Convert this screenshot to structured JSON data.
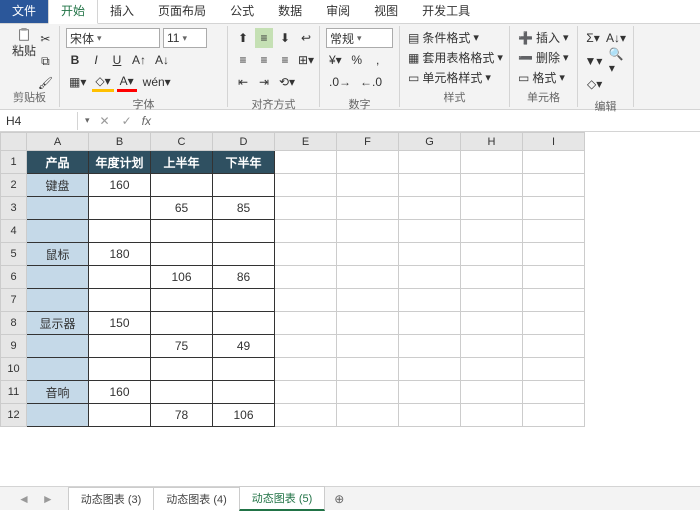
{
  "menu": {
    "file": "文件",
    "home": "开始",
    "insert": "插入",
    "layout": "页面布局",
    "formula": "公式",
    "data": "数据",
    "review": "审阅",
    "view": "视图",
    "dev": "开发工具"
  },
  "ribbon": {
    "paste": "粘贴",
    "clipboard": "剪贴板",
    "font": "宋体",
    "fontsize": "11",
    "fontlabel": "字体",
    "b": "B",
    "i": "I",
    "u": "U",
    "alignlabel": "对齐方式",
    "numberfmt": "常规",
    "numberlabel": "数字",
    "condfmt": "条件格式",
    "tablefmt": "套用表格格式",
    "cellstyle": "单元格样式",
    "styleslabel": "样式",
    "ins": "插入",
    "del": "删除",
    "fmt": "格式",
    "cellslabel": "单元格",
    "editlabel": "编辑"
  },
  "namebox": "H4",
  "cols": [
    "A",
    "B",
    "C",
    "D",
    "E",
    "F",
    "G",
    "H",
    "I"
  ],
  "rows": [
    {
      "n": "1",
      "c": [
        {
          "t": "hdr",
          "v": "产品"
        },
        {
          "t": "hdr",
          "v": "年度计划"
        },
        {
          "t": "hdr",
          "v": "上半年"
        },
        {
          "t": "hdr",
          "v": "下半年"
        }
      ]
    },
    {
      "n": "2",
      "c": [
        {
          "t": "lab",
          "v": "键盘"
        },
        {
          "t": "bord",
          "v": "160"
        },
        {
          "t": "bord",
          "v": ""
        },
        {
          "t": "bord",
          "v": ""
        }
      ]
    },
    {
      "n": "3",
      "c": [
        {
          "t": "lab",
          "v": ""
        },
        {
          "t": "bord",
          "v": ""
        },
        {
          "t": "bord",
          "v": "65"
        },
        {
          "t": "bord",
          "v": "85"
        }
      ]
    },
    {
      "n": "4",
      "c": [
        {
          "t": "lab",
          "v": ""
        },
        {
          "t": "bord",
          "v": ""
        },
        {
          "t": "bord",
          "v": ""
        },
        {
          "t": "bord",
          "v": ""
        }
      ]
    },
    {
      "n": "5",
      "c": [
        {
          "t": "lab",
          "v": "鼠标"
        },
        {
          "t": "bord",
          "v": "180"
        },
        {
          "t": "bord",
          "v": ""
        },
        {
          "t": "bord",
          "v": ""
        }
      ]
    },
    {
      "n": "6",
      "c": [
        {
          "t": "lab",
          "v": ""
        },
        {
          "t": "bord",
          "v": ""
        },
        {
          "t": "bord",
          "v": "106"
        },
        {
          "t": "bord",
          "v": "86"
        }
      ]
    },
    {
      "n": "7",
      "c": [
        {
          "t": "lab",
          "v": ""
        },
        {
          "t": "bord",
          "v": ""
        },
        {
          "t": "bord",
          "v": ""
        },
        {
          "t": "bord",
          "v": ""
        }
      ]
    },
    {
      "n": "8",
      "c": [
        {
          "t": "lab",
          "v": "显示器"
        },
        {
          "t": "bord",
          "v": "150"
        },
        {
          "t": "bord",
          "v": ""
        },
        {
          "t": "bord",
          "v": ""
        }
      ]
    },
    {
      "n": "9",
      "c": [
        {
          "t": "lab",
          "v": ""
        },
        {
          "t": "bord",
          "v": ""
        },
        {
          "t": "bord",
          "v": "75"
        },
        {
          "t": "bord",
          "v": "49"
        }
      ]
    },
    {
      "n": "10",
      "c": [
        {
          "t": "lab",
          "v": ""
        },
        {
          "t": "bord",
          "v": ""
        },
        {
          "t": "bord",
          "v": ""
        },
        {
          "t": "bord",
          "v": ""
        }
      ]
    },
    {
      "n": "11",
      "c": [
        {
          "t": "lab",
          "v": "音响"
        },
        {
          "t": "bord",
          "v": "160"
        },
        {
          "t": "bord",
          "v": ""
        },
        {
          "t": "bord",
          "v": ""
        }
      ]
    },
    {
      "n": "12",
      "c": [
        {
          "t": "lab",
          "v": ""
        },
        {
          "t": "bord",
          "v": ""
        },
        {
          "t": "bord",
          "v": "78"
        },
        {
          "t": "bord",
          "v": "106"
        }
      ]
    }
  ],
  "sheets": {
    "s1": "动态图表 (3)",
    "s2": "动态图表 (4)",
    "s3": "动态图表 (5)"
  }
}
